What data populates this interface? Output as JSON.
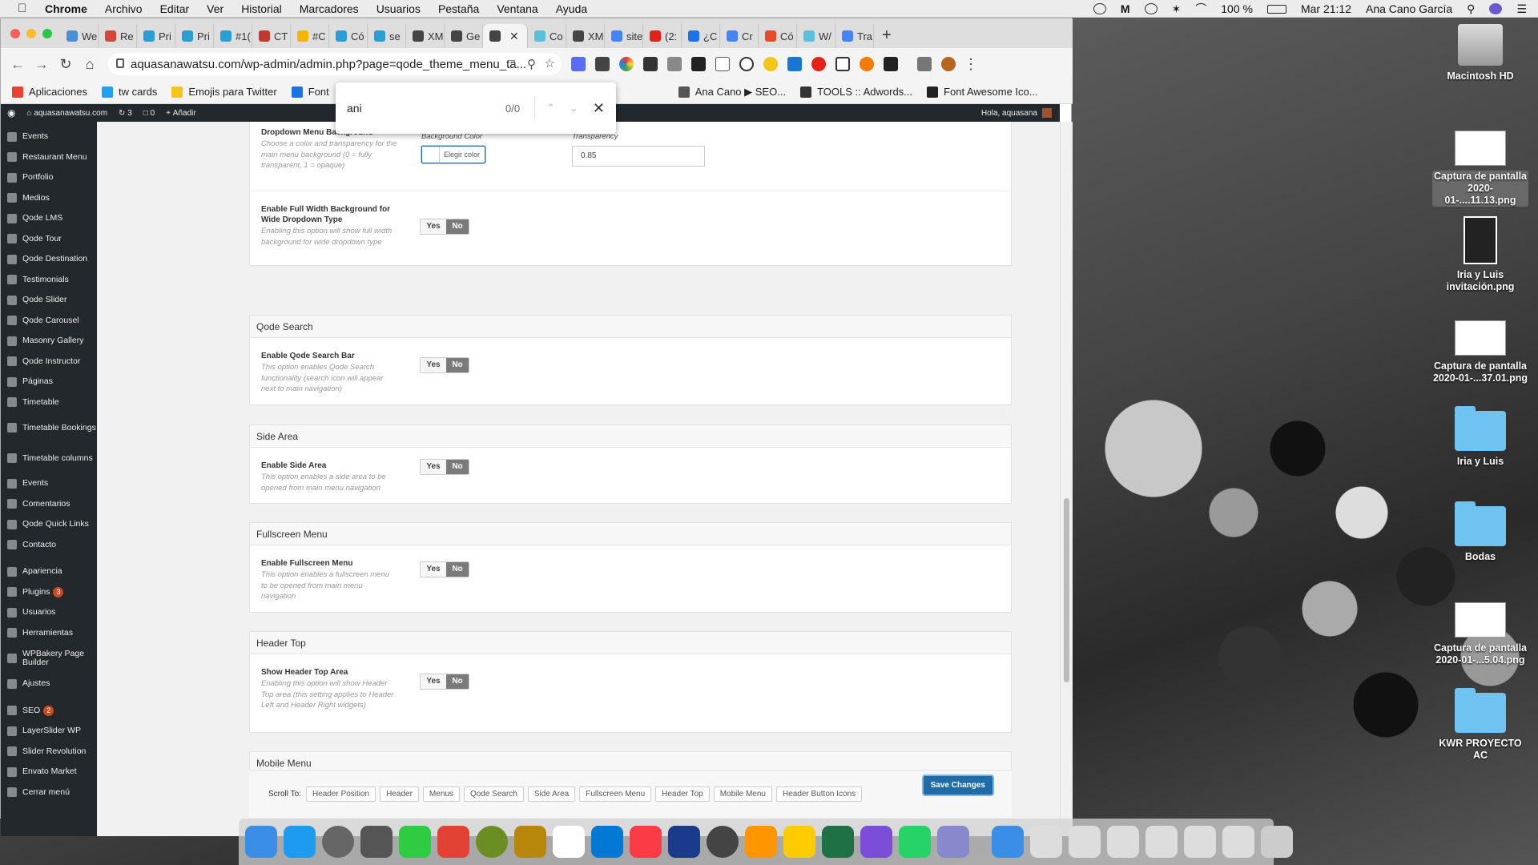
{
  "menubar": {
    "app": "Chrome",
    "items": [
      "Archivo",
      "Editar",
      "Ver",
      "Historial",
      "Marcadores",
      "Usuarios",
      "Pestaña",
      "Ventana",
      "Ayuda"
    ],
    "battery": "100 %",
    "clock": "Mar 21:12",
    "user": "Ana Cano García"
  },
  "tabs": [
    {
      "label": "We",
      "color": "#4a90d9"
    },
    {
      "label": "Re",
      "color": "#d44638"
    },
    {
      "label": "Pri",
      "color": "#2a9fd6"
    },
    {
      "label": "Pri",
      "color": "#2a9fd6"
    },
    {
      "label": "#1(",
      "color": "#2a9fd6"
    },
    {
      "label": "CT",
      "color": "#c0392b"
    },
    {
      "label": "#C",
      "color": "#f4b400"
    },
    {
      "label": "Có",
      "color": "#2a9fd6"
    },
    {
      "label": "se",
      "color": "#2a9fd6"
    },
    {
      "label": "XM",
      "color": "#444"
    },
    {
      "label": "Ge",
      "color": "#444"
    },
    {
      "label": "",
      "color": "#444"
    },
    {
      "label": "Co",
      "color": "#5bc0de"
    },
    {
      "label": "XM",
      "color": "#444"
    },
    {
      "label": "site",
      "color": "#4285f4"
    },
    {
      "label": "(2:",
      "color": "#e62117"
    },
    {
      "label": "¿C",
      "color": "#1a73e8"
    },
    {
      "label": "Cr",
      "color": "#4285f4"
    },
    {
      "label": "Có",
      "color": "#e44d26"
    },
    {
      "label": "W/",
      "color": "#5bc0de"
    },
    {
      "label": "Tra",
      "color": "#4285f4"
    }
  ],
  "address": "aquasanawatsu.com/wp-admin/admin.php?page=qode_theme_menu_ta...",
  "bookmarks": [
    {
      "label": "Aplicaciones",
      "color": "#e94235"
    },
    {
      "label": "tw cards",
      "color": "#1da1f2"
    },
    {
      "label": "Emojis para Twitter",
      "color": "#f5c518"
    },
    {
      "label": "Font",
      "color": "#1a73e8"
    },
    {
      "label": "Ana Cano ▶ SEO...",
      "color": "#555"
    },
    {
      "label": "TOOLS :: Adwords...",
      "color": "#333"
    },
    {
      "label": "Font Awesome Ico...",
      "color": "#222"
    }
  ],
  "find": {
    "query": "ani",
    "count": "0/0"
  },
  "wpbar": {
    "site": "aquasanawatsu.com",
    "updates": "3",
    "comments": "0",
    "add": "Añadir",
    "greeting": "Hola, aquasana"
  },
  "sidebar": [
    {
      "label": "Events"
    },
    {
      "label": "Restaurant Menu"
    },
    {
      "label": "Portfolio"
    },
    {
      "label": "Medios"
    },
    {
      "label": "Qode LMS"
    },
    {
      "label": "Qode Tour"
    },
    {
      "label": "Qode Destination"
    },
    {
      "label": "Testimonials"
    },
    {
      "label": "Qode Slider"
    },
    {
      "label": "Qode Carousel"
    },
    {
      "label": "Masonry Gallery"
    },
    {
      "label": "Qode Instructor"
    },
    {
      "label": "Páginas"
    },
    {
      "label": "Timetable"
    },
    {
      "label": "Timetable Bookings",
      "two": true
    },
    {
      "label": "Timetable columns",
      "two": true
    },
    {
      "label": "Events"
    },
    {
      "label": "Comentarios"
    },
    {
      "label": "Qode Quick Links"
    },
    {
      "label": "Contacto"
    },
    {
      "label": "Apariencia"
    },
    {
      "label": "Plugins",
      "badge": "3"
    },
    {
      "label": "Usuarios"
    },
    {
      "label": "Herramientas"
    },
    {
      "label": "WPBakery Page Builder",
      "two": true
    },
    {
      "label": "Ajustes"
    },
    {
      "label": "SEO",
      "badge": "2"
    },
    {
      "label": "LayerSlider WP"
    },
    {
      "label": "Slider Revolution"
    },
    {
      "label": "Envato Market"
    },
    {
      "label": "Cerrar menú"
    }
  ],
  "dropdown": {
    "label": "Dropdown Menu Background",
    "desc": "Choose a color and transparency for the main menu background (0 = fully transparent, 1 = opaque)",
    "bg_label": "Background Color",
    "bg_button": "Elegir color",
    "trans_label": "Transparency",
    "trans_value": "0.85"
  },
  "fullwidth": {
    "label": "Enable Full Width Background for Wide Dropdown Type",
    "desc": "Enabling this option will show full width background for wide dropdown type"
  },
  "toggle": {
    "yes": "Yes",
    "no": "No"
  },
  "sections": [
    {
      "title": "Qode Search",
      "label": "Enable Qode Search Bar",
      "desc": "This option enables Qode Search functionality (search icon will appear next to main navigation)"
    },
    {
      "title": "Side Area",
      "label": "Enable Side Area",
      "desc": "This option enables a side area to be opened from main menu navigation"
    },
    {
      "title": "Fullscreen Menu",
      "label": "Enable Fullscreen Menu",
      "desc": "This option enables a fullscreen menu to be opened from main menu navigation"
    },
    {
      "title": "Header Top",
      "label": "Show Header Top Area",
      "desc": "Enabling this option will show Header Top area (this setting applies to Header Left and Header Right widgets)"
    }
  ],
  "mobile_title": "Mobile Menu",
  "scroll": {
    "label": "Scroll To:",
    "buttons": [
      "Header Position",
      "Header",
      "Menus",
      "Qode Search",
      "Side Area",
      "Fullscreen Menu",
      "Header Top",
      "Mobile Menu",
      "Header Button Icons"
    ],
    "save": "Save Changes"
  },
  "desktop_icons": [
    {
      "label": "Macintosh HD",
      "kind": "disk"
    },
    {
      "label": "Captura de pantalla 2020-01-....11.13.png",
      "kind": "thumb"
    },
    {
      "label": "Iria y Luis invitación.png",
      "kind": "photo"
    },
    {
      "label": "Captura de pantalla 2020-01-...37.01.png",
      "kind": "thumb"
    },
    {
      "label": "Iria y Luis",
      "kind": "folder"
    },
    {
      "label": "Bodas",
      "kind": "folder"
    },
    {
      "label": "Captura de pantalla 2020-01-...5.04.png",
      "kind": "thumb"
    },
    {
      "label": "KWR PROYECTO AC",
      "kind": "folder"
    }
  ],
  "dock_colors": [
    "#3a8ee6",
    "#1d9bf0",
    "#666",
    "#555",
    "#2ecc40",
    "#e34133",
    "#6b8e23",
    "#b8860b",
    "#fff",
    "#0078d4",
    "#fc3c44",
    "#1a3a8a",
    "#444",
    "#ff9500",
    "#ffcc00",
    "#1e7145",
    "#7b4dd8",
    "#25d366",
    "#88c",
    "#3a8ee6",
    "#ddd",
    "#ddd",
    "#ddd",
    "#ddd",
    "#ddd",
    "#ddd",
    "#ccc"
  ]
}
